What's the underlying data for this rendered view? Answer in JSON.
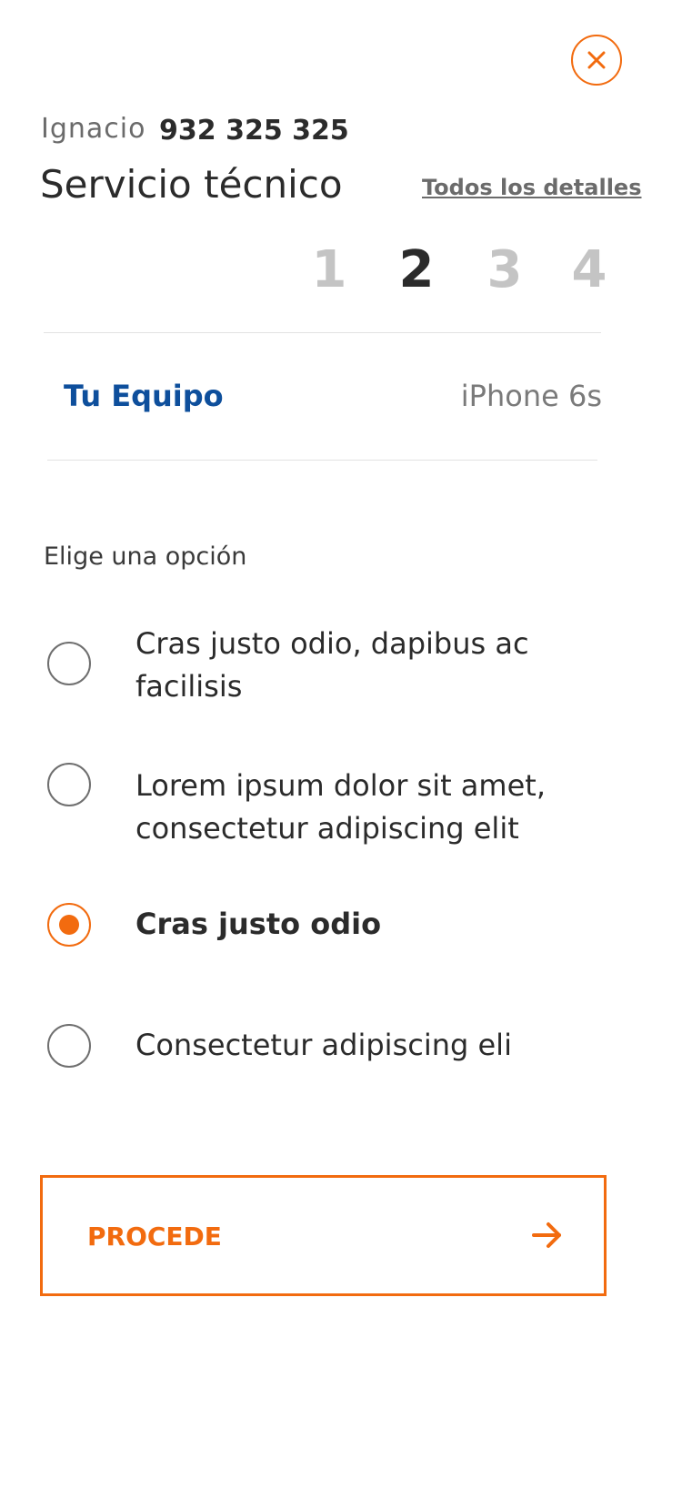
{
  "close": {
    "icon": "close-icon",
    "color": "#f26b0f"
  },
  "user": {
    "name": "Ignacio",
    "phone": "932 325 325"
  },
  "service": {
    "title": "Servicio técnico",
    "details_link": "Todos los detalles"
  },
  "steps": {
    "items": [
      "1",
      "2",
      "3",
      "4"
    ],
    "current": 2
  },
  "device": {
    "label": "Tu Equipo",
    "value": "iPhone 6s"
  },
  "options": {
    "heading": "Elige una opción",
    "items": [
      {
        "label": "Cras justo odio, dapibus ac facilisis",
        "selected": false
      },
      {
        "label": "Lorem ipsum dolor sit amet, consectetur adipiscing elit",
        "selected": false
      },
      {
        "label": "Cras justo odio",
        "selected": true
      },
      {
        "label": "Consectetur adipiscing eli",
        "selected": false
      }
    ]
  },
  "proceed": {
    "label": "PROCEDE",
    "icon": "arrow-right-icon"
  },
  "colors": {
    "accent": "#f26b0f",
    "link_blue": "#0e4f9c",
    "muted": "#c4c4c4"
  }
}
